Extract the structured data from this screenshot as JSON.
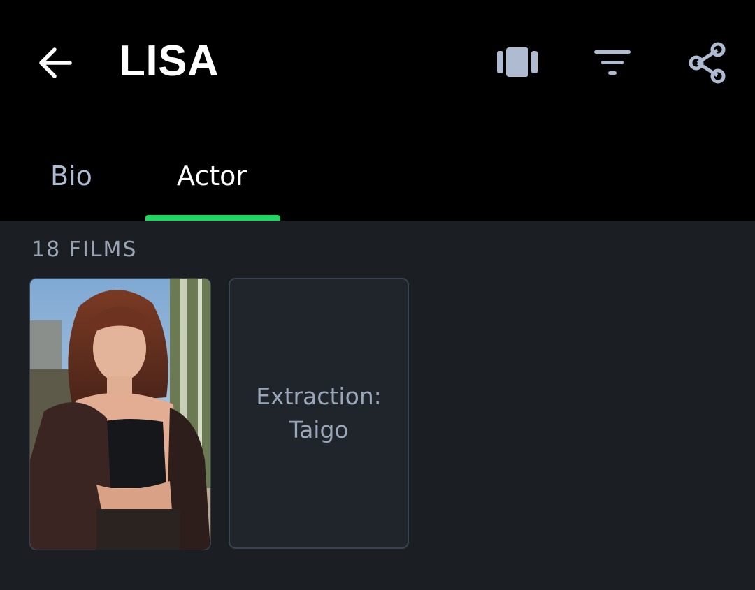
{
  "header": {
    "title": "LISA",
    "back_icon": "arrow-left-icon",
    "actions": [
      {
        "name": "carousel-view-icon"
      },
      {
        "name": "filter-icon"
      },
      {
        "name": "share-icon"
      }
    ]
  },
  "tabs": [
    {
      "label": "Bio",
      "selected": false
    },
    {
      "label": "Actor",
      "selected": true
    }
  ],
  "films": {
    "count_label": "18 FILMS",
    "items": [
      {
        "title": "",
        "has_poster": true
      },
      {
        "title": "Extraction: Taigo",
        "has_poster": false
      }
    ]
  },
  "colors": {
    "accent": "#1ed760",
    "header_bg": "#000000",
    "content_bg": "#1b1f24",
    "icon": "#aebbd0"
  }
}
